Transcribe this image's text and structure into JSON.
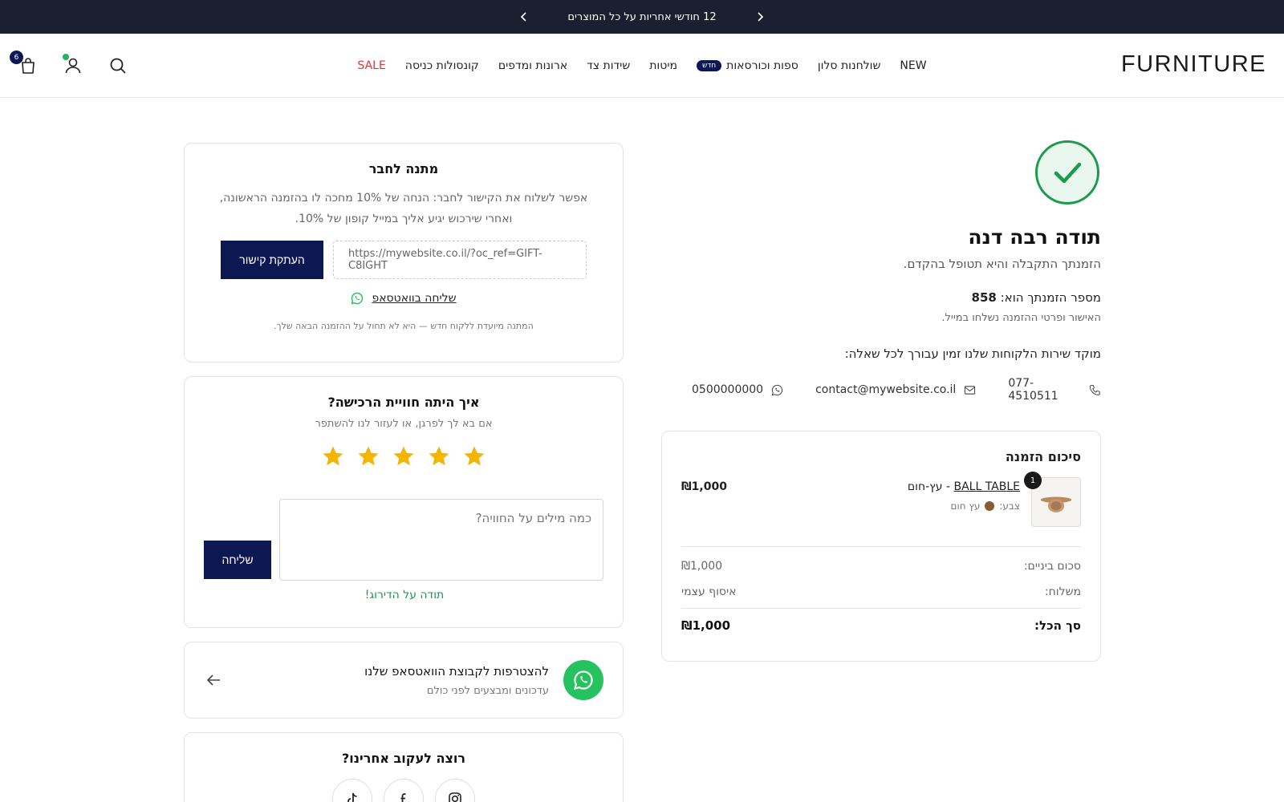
{
  "announcement": {
    "text": "12 חודשי אחריות על כל המוצרים"
  },
  "header": {
    "logo": "FURNITURE",
    "nav": [
      {
        "label": "NEW"
      },
      {
        "label": "שולחנות סלון"
      },
      {
        "label": "ספות וכורסאות",
        "badge": "חדש"
      },
      {
        "label": "מיטות"
      },
      {
        "label": "שידות צד"
      },
      {
        "label": "ארונות ומדפים"
      },
      {
        "label": "קונסולות כניסה"
      },
      {
        "label": "SALE"
      }
    ],
    "cart_count": "6"
  },
  "confirmation": {
    "title": "תודה רבה דנה",
    "subtitle": "הזמנתך התקבלה והיא תטופל בהקדם.",
    "order_label": "מספר הזמנתך הוא:",
    "order_number": "858",
    "email_note": "האישור ופרטי ההזמנה נשלחו במייל.",
    "service_text": "מוקד שירות הלקוחות שלנו זמין עבורך לכל שאלה:",
    "phone": "077-4510511",
    "email": "contact@mywebsite.co.il",
    "whatsapp": "0500000000"
  },
  "summary": {
    "title": "סיכום הזמנה",
    "product": {
      "name": "BALL TABLE",
      "variant_name": "עץ-חום",
      "color_label": "צבע:",
      "color_value": "עץ חום",
      "quantity": "1",
      "price": "₪1,000"
    },
    "subtotal_label": "סכום ביניים:",
    "subtotal_value": "₪1,000",
    "shipping_label": "משלוח:",
    "shipping_value": "איסוף עצמי",
    "total_label": "סך הכל:",
    "total_value": "₪1,000"
  },
  "gift": {
    "title": "מתנה לחבר",
    "text": "אפשר לשלוח את הקישור לחבר: הנחה של 10% מחכה לו בהזמנה הראשונה, ואחרי שירכוש יגיע אליך במייל קופון של 10%.",
    "link": "https://mywebsite.co.il/?oc_ref=GIFT-C8IGHT",
    "copy_label": "העתקת קישור",
    "whatsapp_label": "שליחה בוואטסאפ",
    "note": "המתנה מיועדת ללקוח חדש — היא לא תחול על ההזמנה הבאה שלך."
  },
  "rating": {
    "title": "איך היתה חוויית הרכישה?",
    "subtitle": "אם בא לך לפרגן, או לעזור לנו להשתפר",
    "stars": 5,
    "placeholder": "כמה מילים על החוויה?",
    "send_label": "שליחה",
    "thanks": "תודה על הדירוג!"
  },
  "whatsapp_group": {
    "title": "להצטרפות לקבוצת הוואטסאפ שלנו",
    "subtitle": "עדכונים ומבצעים לפני כולם"
  },
  "follow": {
    "title": "רוצה לעקוב אחרינו?"
  },
  "colors": {
    "brand_navy": "#0d1752",
    "success_green": "#1a9c4c",
    "whatsapp_green": "#25c25f",
    "star_gold": "#f5b400",
    "sale_red": "#d63a3a"
  }
}
